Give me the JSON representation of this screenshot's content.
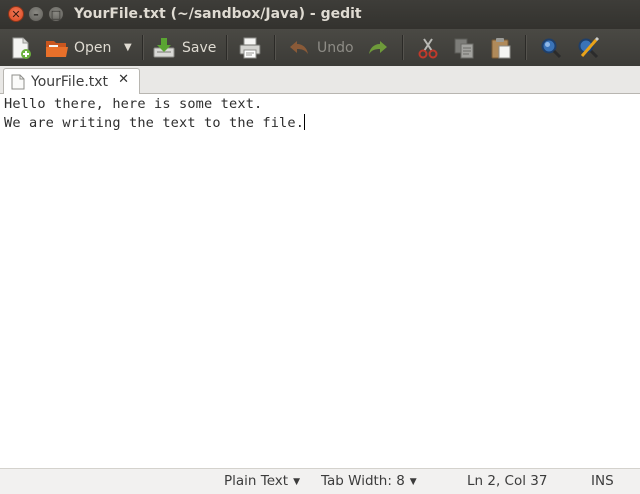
{
  "window": {
    "title": "YourFile.txt (~/sandbox/Java) - gedit",
    "close_glyph": "✕",
    "minimize_glyph": "–",
    "maximize_glyph": "□"
  },
  "toolbar": {
    "new_icon": "new-document-icon",
    "open_label": "Open",
    "open_icon": "folder-open-icon",
    "open_dropdown_glyph": "▼",
    "save_label": "Save",
    "save_icon": "save-download-icon",
    "print_icon": "printer-icon",
    "undo_label": "Undo",
    "undo_icon": "undo-arrow-icon",
    "redo_icon": "redo-arrow-icon",
    "cut_icon": "scissors-icon",
    "copy_icon": "copy-icon",
    "paste_icon": "clipboard-icon",
    "find_icon": "magnifier-icon",
    "replace_icon": "find-replace-icon"
  },
  "tabs": [
    {
      "label": "YourFile.txt",
      "close_glyph": "✕"
    }
  ],
  "editor": {
    "lines": [
      "Hello there, here is some text.",
      "We are writing the text to the file."
    ]
  },
  "statusbar": {
    "language": "Plain Text",
    "tab_width": "Tab Width: 8",
    "position": "Ln 2, Col 37",
    "mode": "INS",
    "dropdown_glyph": "▼"
  },
  "colors": {
    "titlebar": "#3c3b37",
    "toolbar": "#434240",
    "close_button": "#e05a30",
    "editor_bg": "#ffffff"
  }
}
